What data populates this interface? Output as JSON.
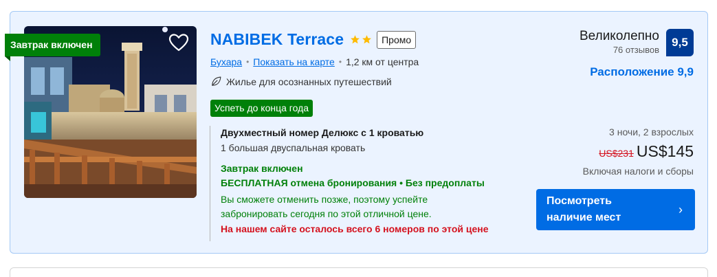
{
  "listing": {
    "ribbon_label": "Завтрак включен",
    "hotel_name": "NABIBEK Terrace",
    "star_count": 2,
    "promo_label": "Промо",
    "city_link": "Бухара",
    "map_link": "Показать на карте",
    "distance": "1,2 км от центра",
    "eco_label": "Жилье для осознанных путешествий",
    "deal_badge": "Успеть до конца года",
    "room": {
      "name": "Двухместный номер Делюкс с 1 кроватью",
      "bed": "1 большая двуспальная кровать",
      "breakfast": "Завтрак включен",
      "cancellation": "БЕСПЛАТНАЯ отмена бронирования • Без предоплаты",
      "cancel_note_line1": "Вы сможете отменить позже, поэтому успейте",
      "cancel_note_line2": "забронировать сегодня по этой отличной цене.",
      "scarcity": "На нашем сайте осталось всего 6 номеров по этой цене"
    },
    "review": {
      "score_word": "Великолепно",
      "reviews_count": "76 отзывов",
      "score": "9,5",
      "location_score": "Расположение 9,9"
    },
    "pricing": {
      "stay": "3 ночи, 2 взрослых",
      "old_price": "US$231",
      "new_price": "US$145",
      "tax_note": "Включая налоги и сборы"
    },
    "cta": {
      "line1": "Посмотреть",
      "line2": "наличие мест",
      "chevron": "›"
    }
  },
  "colors": {
    "brand_blue": "#006ce4",
    "dark_blue": "#003b95",
    "green": "#008009",
    "red": "#d4111e",
    "card_bg": "#ebf3ff"
  },
  "icons": [
    "heart-icon",
    "star-icon",
    "leaf-icon",
    "chevron-right-icon"
  ]
}
